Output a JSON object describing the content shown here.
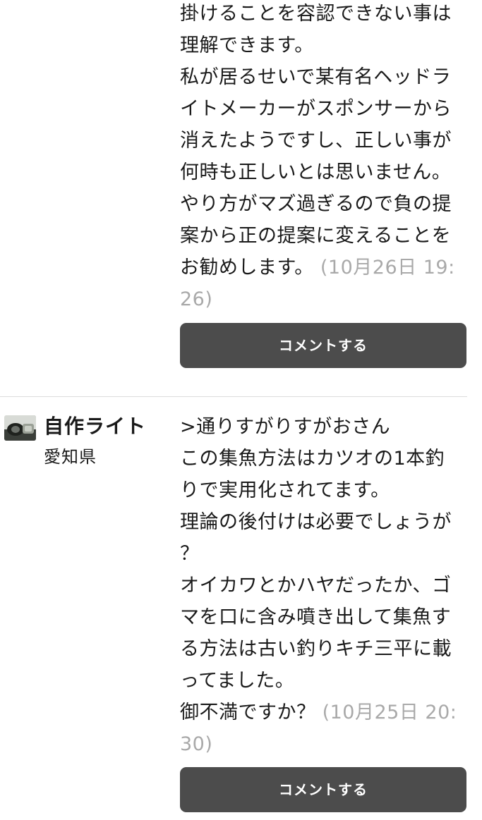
{
  "comments": [
    {
      "body": "掛けることを容認できない事は\n理解できます。\n私が居るせいで某有名ヘッドラ\nイトメーカーがスポンサーから\n消えたようですし、正しい事が\n何時も正しいとは思いません。\nやり方がマズ過ぎるので負の提\n案から正の提案に変えることを\nお勧めします。 ",
      "timestamp": "(10月26日 19:\n26)",
      "button_label": "コメントする"
    },
    {
      "author": {
        "name": "自作ライト",
        "prefecture": "愛知県",
        "avatar_icon": "avatar-photo-icon"
      },
      "body": ">通りすがりすがおさん\nこの集魚方法はカツオの1本釣\nりで実用化されてます。\n理論の後付けは必要でしょうが\n？\nオイカワとかハヤだったか、ゴ\nマを口に含み噴き出して集魚す\nる方法は古い釣りキチ三平に載\nってました。\n御不満ですか？ ",
      "timestamp": "(10月25日 20:\n30)",
      "button_label": "コメントする"
    }
  ],
  "colors": {
    "button_bg": "#4c4c4c",
    "timestamp": "#a9a9a9",
    "divider": "#dcdcdc"
  }
}
